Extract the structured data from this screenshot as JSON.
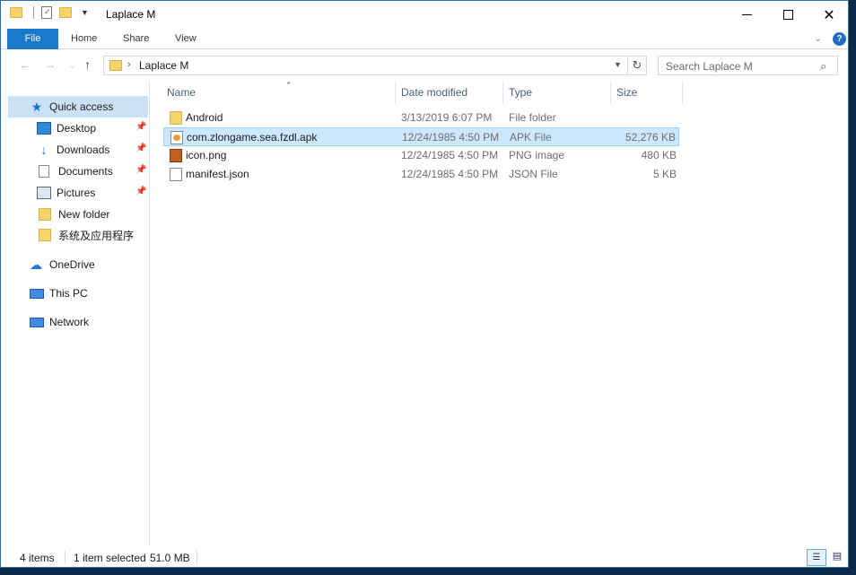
{
  "window": {
    "title": "Laplace M"
  },
  "ribbon": {
    "file": "File",
    "home": "Home",
    "share": "Share",
    "view": "View"
  },
  "address": {
    "path": "Laplace M",
    "search_placeholder": "Search Laplace M"
  },
  "sidebar": {
    "quick_access": "Quick access",
    "items": [
      {
        "label": "Desktop",
        "pinned": true
      },
      {
        "label": "Downloads",
        "pinned": true
      },
      {
        "label": "Documents",
        "pinned": true
      },
      {
        "label": "Pictures",
        "pinned": true
      },
      {
        "label": "New folder",
        "pinned": false
      },
      {
        "label": "系统及应用程序",
        "pinned": false
      }
    ],
    "onedrive": "OneDrive",
    "thispc": "This PC",
    "network": "Network"
  },
  "columns": {
    "name": "Name",
    "date": "Date modified",
    "type": "Type",
    "size": "Size"
  },
  "files": [
    {
      "name": "Android",
      "date": "3/13/2019 6:07 PM",
      "type": "File folder",
      "size": "",
      "icon": "folder-icon",
      "selected": false
    },
    {
      "name": "com.zlongame.sea.fzdl.apk",
      "date": "12/24/1985 4:50 PM",
      "type": "APK File",
      "size": "52,276 KB",
      "icon": "apk-file-icon",
      "selected": true
    },
    {
      "name": "icon.png",
      "date": "12/24/1985 4:50 PM",
      "type": "PNG image",
      "size": "480 KB",
      "icon": "png-file-icon",
      "selected": false
    },
    {
      "name": "manifest.json",
      "date": "12/24/1985 4:50 PM",
      "type": "JSON File",
      "size": "5 KB",
      "icon": "json-file-icon",
      "selected": false
    }
  ],
  "status": {
    "count": "4 items",
    "selected": "1 item selected",
    "size": "51.0 MB"
  }
}
